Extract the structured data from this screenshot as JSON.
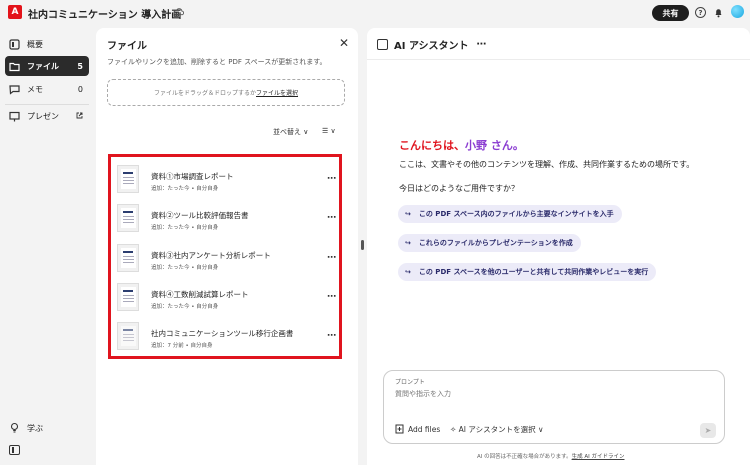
{
  "header": {
    "logo_glyph": "A",
    "title": "社内コミュニケーション 導入計画",
    "share_label": "共有",
    "help_glyph": "?"
  },
  "nav": {
    "items": [
      {
        "label": "概要",
        "count": ""
      },
      {
        "label": "ファイル",
        "count": "5"
      },
      {
        "label": "メモ",
        "count": "0"
      },
      {
        "label": "プレゼン",
        "count": ""
      }
    ],
    "learn_label": "学ぶ"
  },
  "files_panel": {
    "title": "ファイル",
    "close_glyph": "✕",
    "description": "ファイルやリンクを追加、削除すると PDF スペースが更新されます。",
    "dropzone_text": "ファイルをドラッグ＆ドロップするか",
    "dropzone_link": "ファイルを選択",
    "sort_label": "並べ替え ∨",
    "view_glyph": "☰ ∨",
    "more_glyph": "⋯",
    "files": [
      {
        "name": "資料①市場調査レポート",
        "meta": "追加：たった今 • 自分自身"
      },
      {
        "name": "資料②ツール比較評価報告書",
        "meta": "追加：たった今 • 自分自身"
      },
      {
        "name": "資料③社内アンケート分析レポート",
        "meta": "追加：たった今 • 自分自身"
      },
      {
        "name": "資料④工数削減試算レポート",
        "meta": "追加：たった今 • 自分自身"
      },
      {
        "name": "社内コミュニケーションツール移行企画書",
        "meta": "追加：7 分前 • 自分自身"
      }
    ]
  },
  "ai": {
    "title": "AI アシスタント",
    "more_glyph": "⋯",
    "greeting_part1": "こんにちは、",
    "greeting_part2": "小野 さん。",
    "intro": "ここは、文書やその他のコンテンツを理解、作成、共同作業するための場所です。",
    "ask": "今日はどのようなご用件ですか？",
    "suggestions": [
      "この PDF スペース内のファイルから主要なインサイトを入手",
      "これらのファイルからプレゼンテーションを作成",
      "この PDF スペースを他のユーザーと共有して共同作業やレビューを実行"
    ],
    "arrow_glyph": "↪",
    "prompt_label": "プロンプト",
    "prompt_placeholder": "質問や指示を入力",
    "add_files_label": "Add files",
    "pick_ai_label": "✧ AI アシスタントを選択 ∨",
    "send_glyph": "➤",
    "disclaimer_text": "AI の回答は不正確な場合があります。",
    "disclaimer_link": "生成 AI ガイドライン"
  },
  "colors": {
    "highlight_border": "#e0141e",
    "greeting_red": "#e0141e",
    "greeting_purple": "#8a3bd1",
    "suggestion_bg": "#ecebf8"
  }
}
